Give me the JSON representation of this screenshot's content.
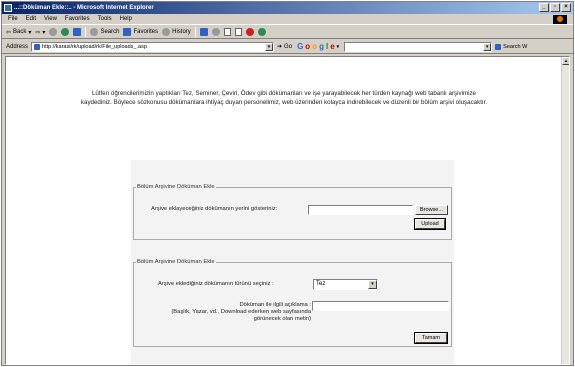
{
  "window": {
    "title": "...::Döküman Ekle::.. - Microsoft Internet Explorer",
    "controls": [
      "_",
      "▫",
      "×"
    ]
  },
  "menu": [
    "File",
    "Edit",
    "View",
    "Favorites",
    "Tools",
    "Help"
  ],
  "toolbar": {
    "back": "Back",
    "search": "Search",
    "favorites": "Favorites",
    "history": "History"
  },
  "address": {
    "label": "Address",
    "url": "http://karasi/rk/upload/rk/File_uploads_.asp",
    "go": "Go",
    "google_letters": [
      "G",
      "o",
      "o",
      "g",
      "l",
      "e"
    ],
    "search_web": "Search W"
  },
  "intro": {
    "line1": "Lütfen öğrencilerimizin yaptıkları Tez, Seminer, Çeviri, Ödev gibi dökümanları ve işe yarayabilecek her türden kaynağı web tabanlı arşivimize",
    "line2": "kaydediniz. Böylece sözkonusu dökümanlara ihtiyaç duyan personelimiz, web üzerinden kolayca indirebilecek ve düzenli bir bölüm arşivi oluşacaktır."
  },
  "upload_form": {
    "legend": "Bölüm Arşivine Döküman Ekle",
    "file_label": "Arşive eklayeceğiniz dökümanın yerini gösteriniz:",
    "browse_button": "Browse...",
    "upload_button": "Upload"
  },
  "type_form": {
    "legend": "Bölüm Arşivine Döküman Ekle",
    "type_label": "Arşive eklediğiniz dökümanın türünü seçiniz :",
    "type_value": "Tez",
    "desc_label_1": "Döküman ile ilgili açıklama :",
    "desc_label_2": "(Başlık, Yazar, vd., Download ederken web sayfasında",
    "desc_label_3": "görünecek olan metin)",
    "submit_button": "Tamam"
  }
}
